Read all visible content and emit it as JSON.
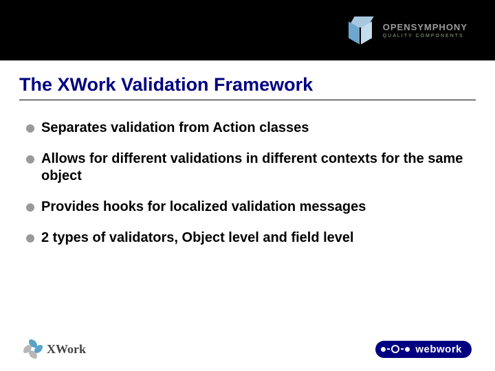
{
  "header": {
    "logo_main": "OPENSYMPHONY",
    "logo_sub": "QUALITY COMPONENTS"
  },
  "title": "The XWork Validation Framework",
  "bullets": [
    "Separates validation from Action classes",
    "Allows for different validations in different contexts for the same object",
    "Provides hooks for localized validation messages",
    "2 types of validators, Object level and field level"
  ],
  "footer": {
    "left_logo_text": "XWork",
    "right_logo_text": "webwork"
  }
}
